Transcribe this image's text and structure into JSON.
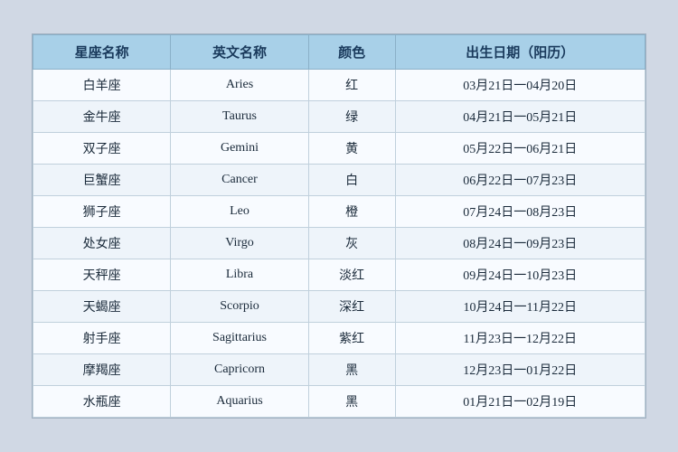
{
  "table": {
    "headers": [
      "星座名称",
      "英文名称",
      "颜色",
      "出生日期（阳历）"
    ],
    "rows": [
      [
        "白羊座",
        "Aries",
        "红",
        "03月21日一04月20日"
      ],
      [
        "金牛座",
        "Taurus",
        "绿",
        "04月21日一05月21日"
      ],
      [
        "双子座",
        "Gemini",
        "黄",
        "05月22日一06月21日"
      ],
      [
        "巨蟹座",
        "Cancer",
        "白",
        "06月22日一07月23日"
      ],
      [
        "狮子座",
        "Leo",
        "橙",
        "07月24日一08月23日"
      ],
      [
        "处女座",
        "Virgo",
        "灰",
        "08月24日一09月23日"
      ],
      [
        "天秤座",
        "Libra",
        "淡红",
        "09月24日一10月23日"
      ],
      [
        "天蝎座",
        "Scorpio",
        "深红",
        "10月24日一11月22日"
      ],
      [
        "射手座",
        "Sagittarius",
        "紫红",
        "11月23日一12月22日"
      ],
      [
        "摩羯座",
        "Capricorn",
        "黑",
        "12月23日一01月22日"
      ],
      [
        "水瓶座",
        "Aquarius",
        "黑",
        "01月21日一02月19日"
      ]
    ]
  }
}
